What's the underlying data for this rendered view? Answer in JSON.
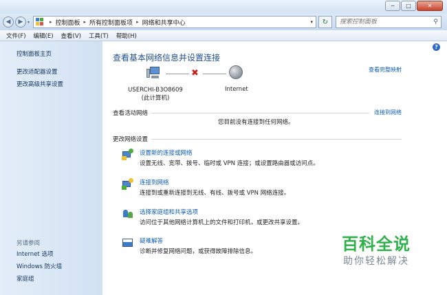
{
  "window": {
    "minimize_glyph": "−",
    "maximize_glyph": "□",
    "close_glyph": "✕"
  },
  "address": {
    "back_glyph": "◀",
    "forward_glyph": "▶",
    "history_glyph": "▾",
    "breadcrumbs": [
      "控制面板",
      "所有控制面板项",
      "网络和共享中心"
    ],
    "separator_glyph": "▸",
    "dropdown_glyph": "▾",
    "refresh_glyph": "↻",
    "search_placeholder": "搜索控制面板",
    "search_glyph": "⚲"
  },
  "menu": [
    "文件(F)",
    "编辑(E)",
    "查看(V)",
    "工具(T)",
    "帮助(H)"
  ],
  "sidebar": {
    "home": "控制面板主页",
    "links": [
      "更改适配器设置",
      "更改高级共享设置"
    ],
    "see_also_title": "另请参阅",
    "see_also": [
      "Internet 选项",
      "Windows 防火墙",
      "家庭组"
    ]
  },
  "main": {
    "help_glyph": "?",
    "heading": "查看基本网络信息并设置连接",
    "full_map_link": "查看完整映射",
    "computer_name": "USERCHI-B3O8609",
    "computer_sub": "(此计算机)",
    "x_glyph": "✖",
    "internet_label": "Internet",
    "active_title": "查看活动网络",
    "connect_link": "连接到网络",
    "no_connection": "您目前没有连接到任何网络。",
    "change_title": "更改网络设置",
    "tasks": [
      {
        "link": "设置新的连接或网络",
        "desc": "设置无线、宽带、拨号、临时或 VPN 连接；或设置路由器或访问点。"
      },
      {
        "link": "连接到网络",
        "desc": "连接到或重新连接到无线、有线、拨号或 VPN 网络连接。"
      },
      {
        "link": "选择家庭组和共享选项",
        "desc": "访问位于其他网络计算机上的文件和打印机，或更改共享设置。"
      },
      {
        "link": "疑难解答",
        "desc": "诊断并修复网络问题，或获得故障排除信息。"
      }
    ]
  },
  "watermark": {
    "title": "百科全说",
    "subtitle": "助你轻松解决"
  },
  "colors": {
    "link": "#0c5bb5",
    "heading": "#1e4f8f",
    "sidebar_bg": "#d9e6f5",
    "error_x": "#c8231b",
    "watermark_green": "#2fb04a"
  }
}
